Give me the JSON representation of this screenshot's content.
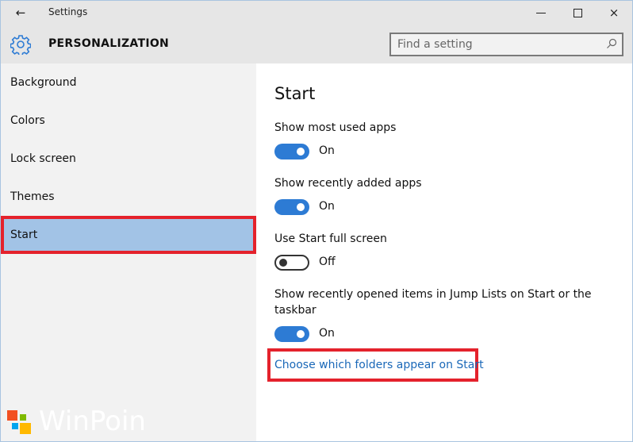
{
  "window": {
    "title": "Settings",
    "back_icon": "←",
    "controls": {
      "minimize": "minimize-icon",
      "maximize": "maximize-icon",
      "close": "×"
    }
  },
  "header": {
    "icon": "gear-icon",
    "section_title": "PERSONALIZATION",
    "search": {
      "placeholder": "Find a setting",
      "value": ""
    }
  },
  "sidebar": {
    "items": [
      {
        "label": "Background",
        "selected": false
      },
      {
        "label": "Colors",
        "selected": false
      },
      {
        "label": "Lock screen",
        "selected": false
      },
      {
        "label": "Themes",
        "selected": false
      },
      {
        "label": "Start",
        "selected": true
      }
    ],
    "watermark": "WinPoin"
  },
  "main": {
    "title": "Start",
    "settings": [
      {
        "label": "Show most used apps",
        "state": "On",
        "enabled": true
      },
      {
        "label": "Show recently added apps",
        "state": "On",
        "enabled": true
      },
      {
        "label": "Use Start full screen",
        "state": "Off",
        "enabled": false
      },
      {
        "label": "Show recently opened items in Jump Lists on Start or the taskbar",
        "state": "On",
        "enabled": true
      }
    ],
    "link": "Choose which folders appear on Start"
  },
  "colors": {
    "accent": "#2d7bd4",
    "selection": "#a2c3e6",
    "highlight_border": "#e4222c",
    "link": "#1a68b8"
  }
}
